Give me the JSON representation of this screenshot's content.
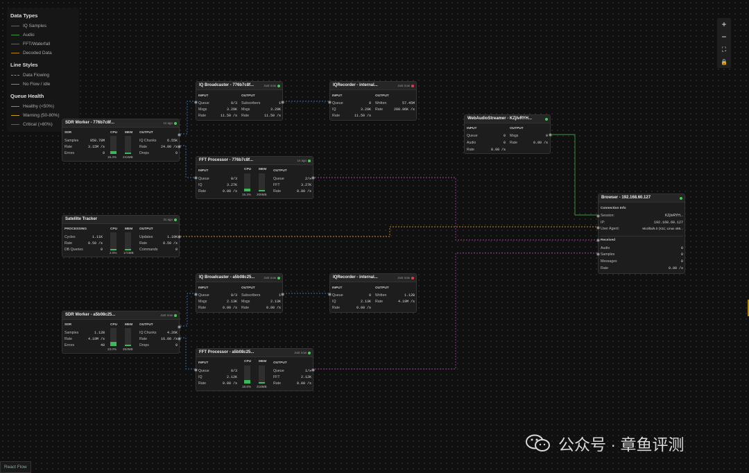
{
  "legend": {
    "data_types_title": "Data Types",
    "data_types": [
      {
        "label": "IQ Samples",
        "color": "#2f6fb8"
      },
      {
        "label": "Audio",
        "color": "#3c9a3c"
      },
      {
        "label": "FFT/Waterfall",
        "color": "#a33aa3"
      },
      {
        "label": "Decoded Data",
        "color": "#b8860b"
      }
    ],
    "line_styles_title": "Line Styles",
    "line_styles": [
      {
        "label": "Data Flowing",
        "style": "dashed"
      },
      {
        "label": "No Flow / idle",
        "style": "solid"
      }
    ],
    "queue_health_title": "Queue Health",
    "queue_health": [
      {
        "label": "Healthy (<50%)",
        "color": "#3cbf3c"
      },
      {
        "label": "Warning (50-80%)",
        "color": "#c8a020"
      },
      {
        "label": "Critical (>80%)",
        "color": "#d03030"
      }
    ]
  },
  "nodes": {
    "sdr1": {
      "title": "SDR Worker - 776b7c8f...",
      "ts": "1s ago",
      "sdr": "SDR",
      "cpu": "CPU",
      "mem": "MEM",
      "output": "OUTPUT",
      "rows_left": [
        [
          "Samples",
          "850.78M"
        ],
        [
          "Rate",
          "3.15M /s"
        ],
        [
          "Errors",
          "0"
        ]
      ],
      "rows_right": [
        [
          "IQ Chunks",
          "6.55K"
        ],
        [
          "Rate",
          "24.00 /s"
        ],
        [
          "Drops",
          "0"
        ]
      ],
      "cpu_val": "15.4%",
      "mem_val": "241MB",
      "cpu_level": 0.15,
      "mem_level": 0.0
    },
    "iqb1": {
      "title": "IQ Broadcaster - 776b7c8f...",
      "ts": "Just now",
      "input": "INPUT",
      "output": "OUTPUT",
      "rows_left": [
        [
          "Queue",
          "0/3"
        ],
        [
          "Msgs",
          "3.29K"
        ],
        [
          "Rate",
          "11.50 /s"
        ]
      ],
      "rows_right": [
        [
          "Subscribers",
          "1"
        ],
        [
          "Msgs",
          "3.29K"
        ],
        [
          "Rate",
          "11.50 /s"
        ]
      ]
    },
    "iqr1": {
      "title": "IQRecorder - internal...",
      "ts": "Just now",
      "input": "INPUT",
      "output": "OUTPUT",
      "rows_left": [
        [
          "Queue",
          "0"
        ],
        [
          "IQ",
          "3.29K"
        ],
        [
          "Rate",
          "11.50 /s"
        ]
      ],
      "rows_right": [
        [
          "Written",
          "57.45M"
        ],
        [
          "Rate",
          "200.96K /s"
        ]
      ]
    },
    "fft1": {
      "title": "FFT Processor - 776b7c8f...",
      "ts": "1s ago",
      "input": "INPUT",
      "cpu": "CPU",
      "mem": "MEM",
      "output": "OUTPUT",
      "rows_left": [
        [
          "Queue",
          "0/3"
        ],
        [
          "IQ",
          "3.27K"
        ],
        [
          "Rate",
          "0.00 /s"
        ]
      ],
      "rows_right": [
        [
          "Queue",
          "2/∞"
        ],
        [
          "FFT",
          "3.27K"
        ],
        [
          "Rate",
          "0.00 /s"
        ]
      ],
      "cpu_val": "15.3%",
      "mem_val": "208MB",
      "cpu_level": 0.15,
      "mem_level": 0.0
    },
    "was": {
      "title": "WebAudioStreamer - KZjIvRYH...",
      "input": "INPUT",
      "output": "OUTPUT",
      "rows_left": [
        [
          "Queue",
          "0"
        ],
        [
          "Audio",
          "0"
        ],
        [
          "Rate",
          "0.00 /s"
        ]
      ],
      "rows_right": [
        [
          "Msgs",
          "0"
        ],
        [
          "Rate",
          "0.00 /s"
        ]
      ]
    },
    "sat": {
      "title": "Satellite Tracker",
      "ts": "2s ago",
      "processing": "PROCESSING",
      "cpu": "CPU",
      "mem": "MEM",
      "output": "OUTPUT",
      "rows_left": [
        [
          "Cycles",
          "1.11K"
        ],
        [
          "Rate",
          "0.50 /s"
        ],
        [
          "DB Queries",
          "0"
        ]
      ],
      "rows_right": [
        [
          "Updates",
          "1.10K"
        ],
        [
          "Rate",
          "0.50 /s"
        ],
        [
          "Commands",
          "0"
        ]
      ],
      "cpu_val": "2.0%",
      "mem_val": "171MB",
      "cpu_level": 0.02,
      "mem_level": 0.0
    },
    "browser": {
      "title": "Browser - 192.168.60.127",
      "conn": "Connection Info",
      "rows_conn": [
        [
          "Session:",
          "KZjIvRYH..."
        ],
        [
          "IP:",
          "192.168.60.127"
        ],
        [
          "User Agent:",
          "Mozilla/5.0 (X11; Linux x86..."
        ]
      ],
      "received": "Received",
      "rows_recv": [
        [
          "Audio",
          "0"
        ],
        [
          "Samples",
          "0"
        ],
        [
          "Messages",
          "0"
        ],
        [
          "Rate",
          "0.00 /s"
        ]
      ]
    },
    "iqb2": {
      "title": "IQ Broadcaster - a5b08c25...",
      "ts": "Just now",
      "input": "INPUT",
      "output": "OUTPUT",
      "rows_left": [
        [
          "Queue",
          "0/3"
        ],
        [
          "Msgs",
          "2.13K"
        ],
        [
          "Rate",
          "0.00 /s"
        ]
      ],
      "rows_right": [
        [
          "Subscribers",
          "1"
        ],
        [
          "Msgs",
          "2.13K"
        ],
        [
          "Rate",
          "0.00 /s"
        ]
      ]
    },
    "iqr2": {
      "title": "IQRecorder - internal...",
      "ts": "Just now",
      "input": "INPUT",
      "output": "OUTPUT",
      "rows_left": [
        [
          "Queue",
          "0"
        ],
        [
          "IQ",
          "2.13K"
        ],
        [
          "Rate",
          "0.00 /s"
        ]
      ],
      "rows_right": [
        [
          "Written",
          "1.12B"
        ],
        [
          "Rate",
          "4.19M /s"
        ]
      ]
    },
    "sdr2": {
      "title": "SDR Worker - a5b08c25...",
      "ts": "Just now",
      "sdr": "SDR",
      "cpu": "CPU",
      "mem": "MEM",
      "output": "OUTPUT",
      "rows_left": [
        [
          "Samples",
          "1.12B"
        ],
        [
          "Rate",
          "4.19M /s"
        ],
        [
          "Errors",
          "40"
        ]
      ],
      "rows_right": [
        [
          "IQ Chunks",
          "4.26K"
        ],
        [
          "Rate",
          "16.00 /s"
        ],
        [
          "Drops",
          "0"
        ]
      ],
      "cpu_val": "23.0%",
      "mem_val": "262MB",
      "cpu_level": 0.23,
      "mem_level": 0.0
    },
    "fft2": {
      "title": "FFT Processor - a5b08c25...",
      "ts": "Just now",
      "input": "INPUT",
      "cpu": "CPU",
      "mem": "MEM",
      "output": "OUTPUT",
      "rows_left": [
        [
          "Queue",
          "0/3"
        ],
        [
          "IQ",
          "2.12K"
        ],
        [
          "Rate",
          "0.00 /s"
        ]
      ],
      "rows_right": [
        [
          "Queue",
          "1/∞"
        ],
        [
          "FFT",
          "2.12K"
        ],
        [
          "Rate",
          "0.00 /s"
        ]
      ],
      "cpu_val": "18.8%",
      "mem_val": "218MB",
      "cpu_level": 0.19,
      "mem_level": 0.0
    }
  },
  "controls": {
    "zoom_in": "+",
    "zoom_out": "−",
    "fit": "⛶",
    "lock": "🔒"
  },
  "attribution": "React Flow",
  "watermark": "公众号 · 章鱼评测"
}
